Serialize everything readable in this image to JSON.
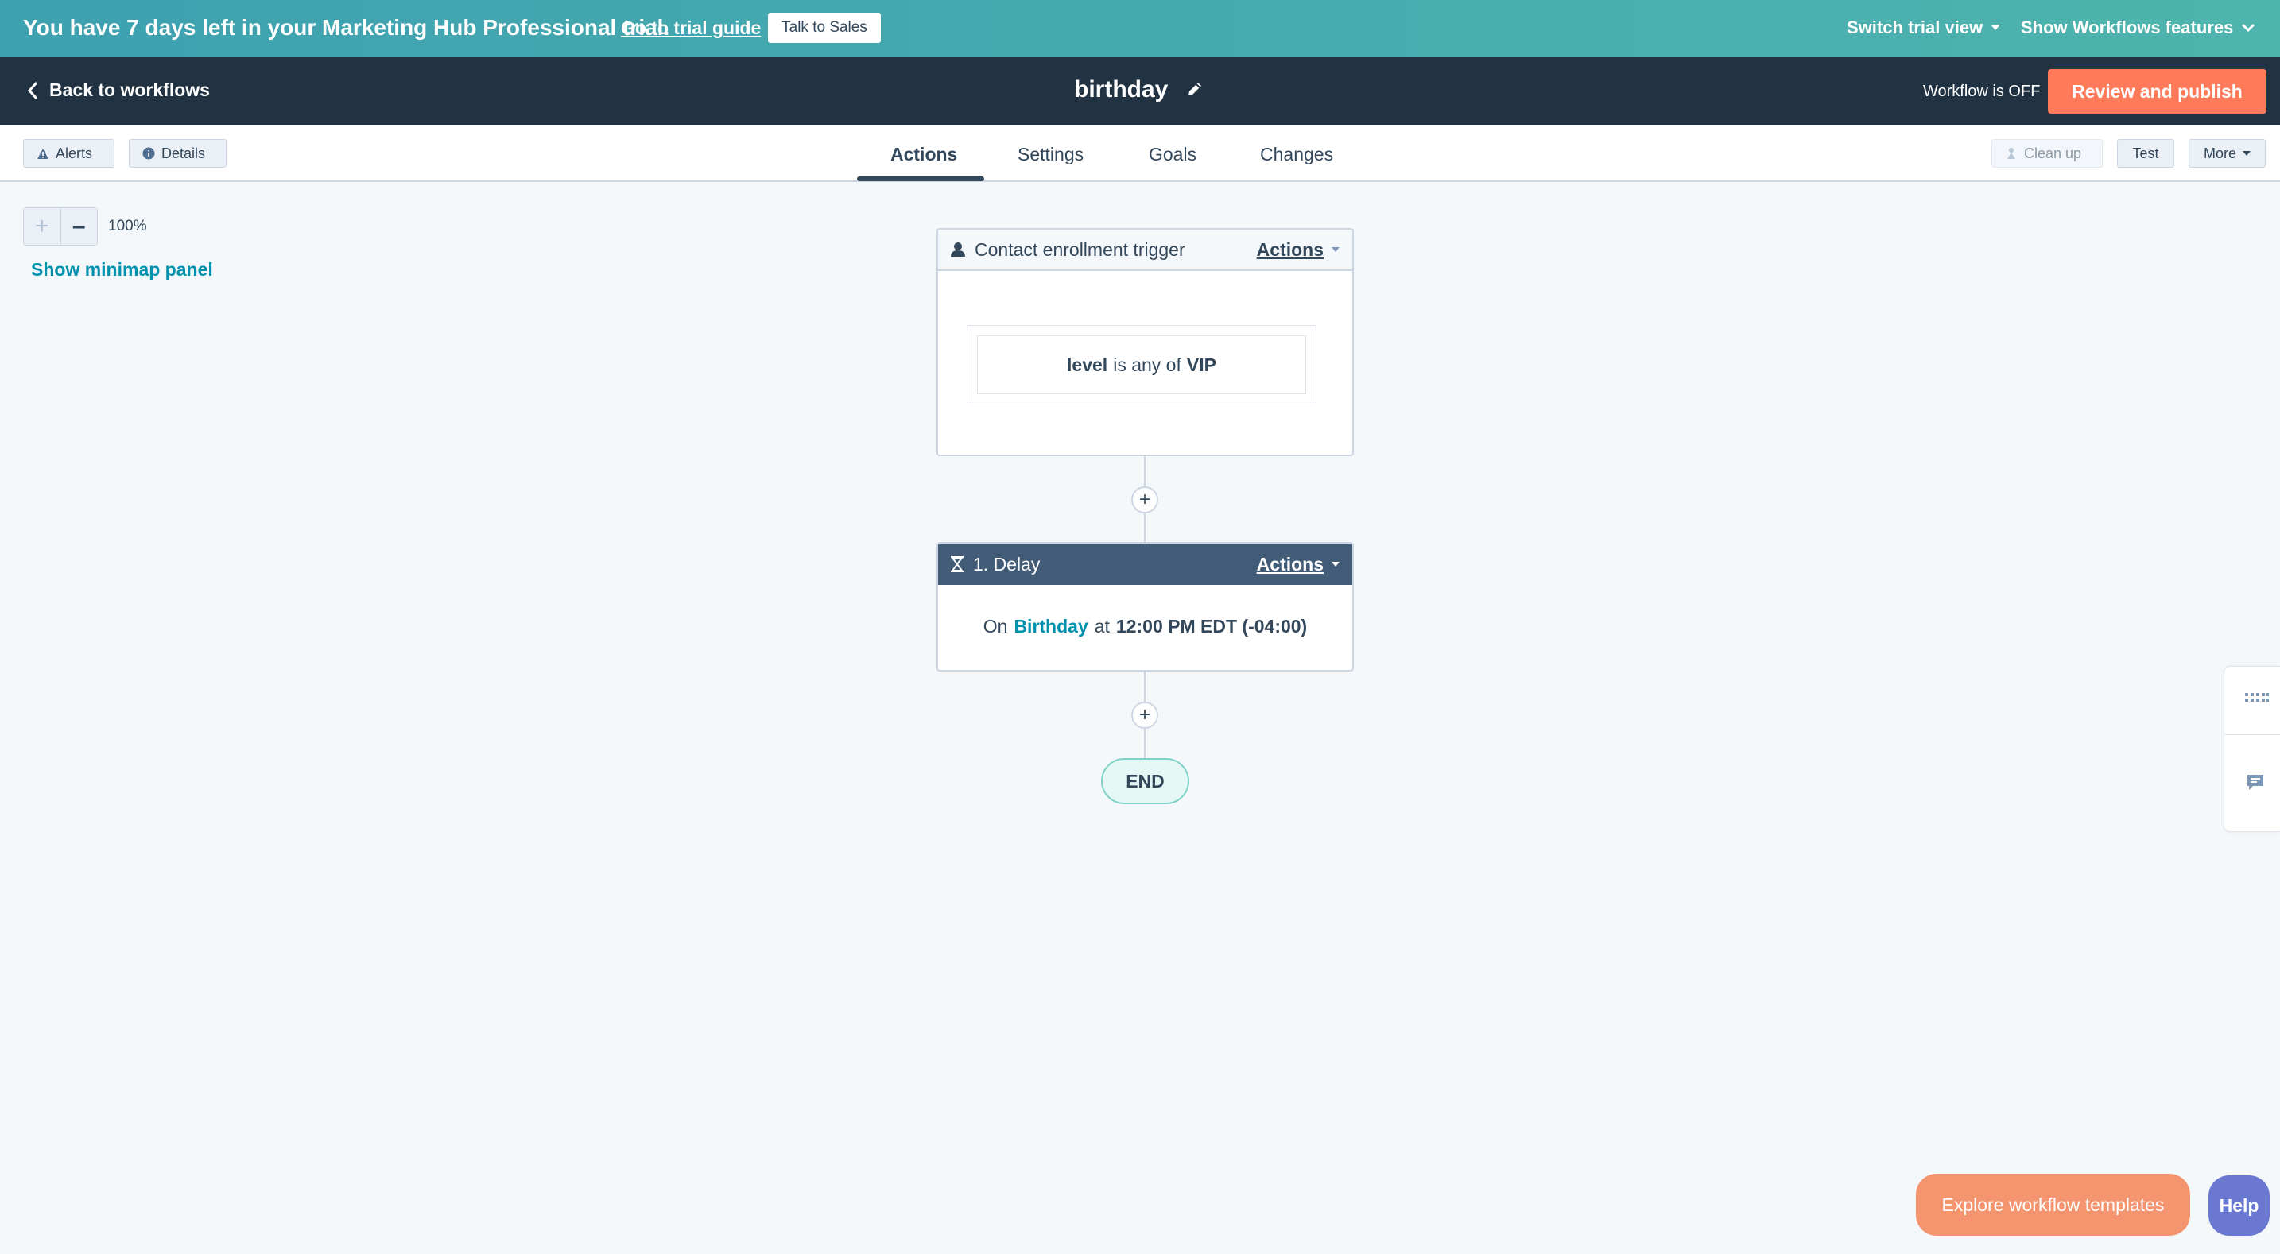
{
  "trial_banner": {
    "message": "You have 7 days left in your Marketing Hub Professional trial.",
    "guide_link": "Go to trial guide",
    "sales_button": "Talk to Sales",
    "switch_view": "Switch trial view",
    "show_features": "Show Workflows features"
  },
  "header": {
    "back_label": "Back to workflows",
    "workflow_name": "birthday",
    "status": "Workflow is OFF",
    "publish_label": "Review and publish"
  },
  "toolbar": {
    "alerts_label": "Alerts",
    "details_label": "Details",
    "tabs": [
      {
        "label": "Actions",
        "active": true
      },
      {
        "label": "Settings",
        "active": false
      },
      {
        "label": "Goals",
        "active": false
      },
      {
        "label": "Changes",
        "active": false
      }
    ],
    "cleanup_label": "Clean up",
    "test_label": "Test",
    "more_label": "More"
  },
  "canvas": {
    "zoom_in": "+",
    "zoom_out": "–",
    "zoom_level": "100%",
    "minimap_link": "Show minimap panel",
    "trigger": {
      "title": "Contact enrollment trigger",
      "actions_label": "Actions",
      "criteria_property": "level",
      "criteria_operator": "is any of",
      "criteria_value": "VIP"
    },
    "delay": {
      "title": "1. Delay",
      "actions_label": "Actions",
      "prefix": "On",
      "property": "Birthday",
      "middle": "at",
      "time": "12:00 PM EDT (-04:00)"
    },
    "add_symbol": "+",
    "end_label": "END"
  },
  "side_rail": {
    "icons": [
      "keyboard-icon",
      "chat-icon"
    ]
  },
  "bottom": {
    "explore_label": "Explore workflow templates",
    "help_label": "Help"
  },
  "colors": {
    "banner": "#45a9b0",
    "header": "#213343",
    "primary_button": "#ff7a59",
    "link": "#0091ae",
    "delay_header": "#425b76",
    "help": "#6a78d1"
  }
}
